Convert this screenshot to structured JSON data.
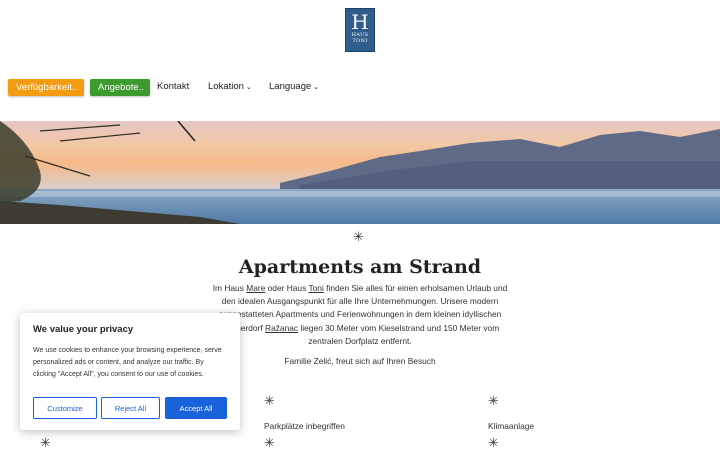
{
  "logo": {
    "letter": "H",
    "line1": "HAUS",
    "line2": "TONI"
  },
  "nav": {
    "availability": "Verfügbarkeit..",
    "offers": "Angebote..",
    "contact": "Kontakt",
    "location": "Lokation",
    "language": "Language",
    "caret": "⌄"
  },
  "main": {
    "ornament": "✳",
    "title": "Apartments am Strand",
    "intro": {
      "p1": "Im Haus ",
      "mare": "Mare",
      "p2": " oder Haus ",
      "toni": "Toni",
      "p3": " finden Sie alles für einen erholsamen Urlaub und den idealen Ausgangspunkt für alle Ihre Unternehmungen. Unsere modern ausgestatteten Apartments und Ferienwohnungen in dem kleinen idyllischen Fischerdorf ",
      "razanac": "Ražanac",
      "p4": " liegen 30 Meter vom Kieselstrand und 150 Meter vom zentralen Dorfplatz entfernt."
    },
    "greeting": "Familie Zelić, freut sich auf Ihren Besuch",
    "features": [
      "Parkplätze inbegriffen",
      "Klimaanlage"
    ]
  },
  "cookie": {
    "title": "We value your privacy",
    "body": "We use cookies to enhance your browsing experience, serve personalized ads or content, and analyze our traffic. By clicking \"Accept All\", you consent to our use of cookies.",
    "customize": "Customize",
    "reject": "Reject All",
    "accept": "Accept All"
  },
  "colors": {
    "logo": "#2f5d8c",
    "availability_button": "#f39c12",
    "offers_button": "#3d9a2f",
    "cookie_accent": "#1863dc"
  }
}
